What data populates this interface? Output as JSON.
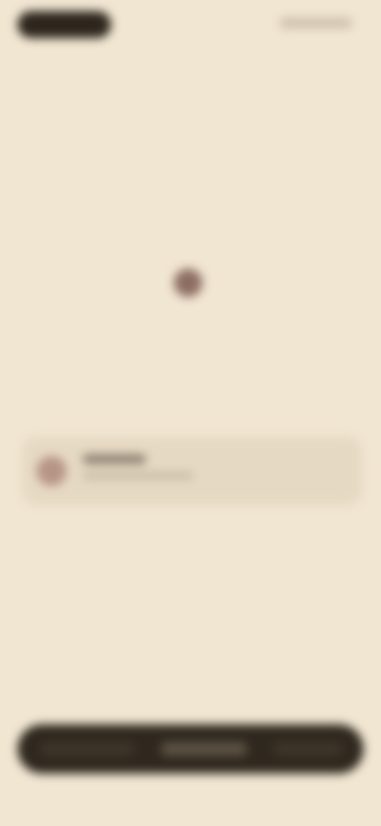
{
  "top": {
    "left_button_label": "",
    "right_link_label": ""
  },
  "hero": {
    "icon_name": "heart-icon",
    "headline": ""
  },
  "card": {
    "avatar_icon": "avatar",
    "title": "",
    "subtitle": ""
  },
  "bottom_bar": {
    "left_label": "",
    "middle_label": "",
    "right_label": ""
  },
  "colors": {
    "background": "#f1e6d2",
    "dark": "#2d261d",
    "accent": "#8d6d62",
    "card": "#e6d9c3"
  }
}
